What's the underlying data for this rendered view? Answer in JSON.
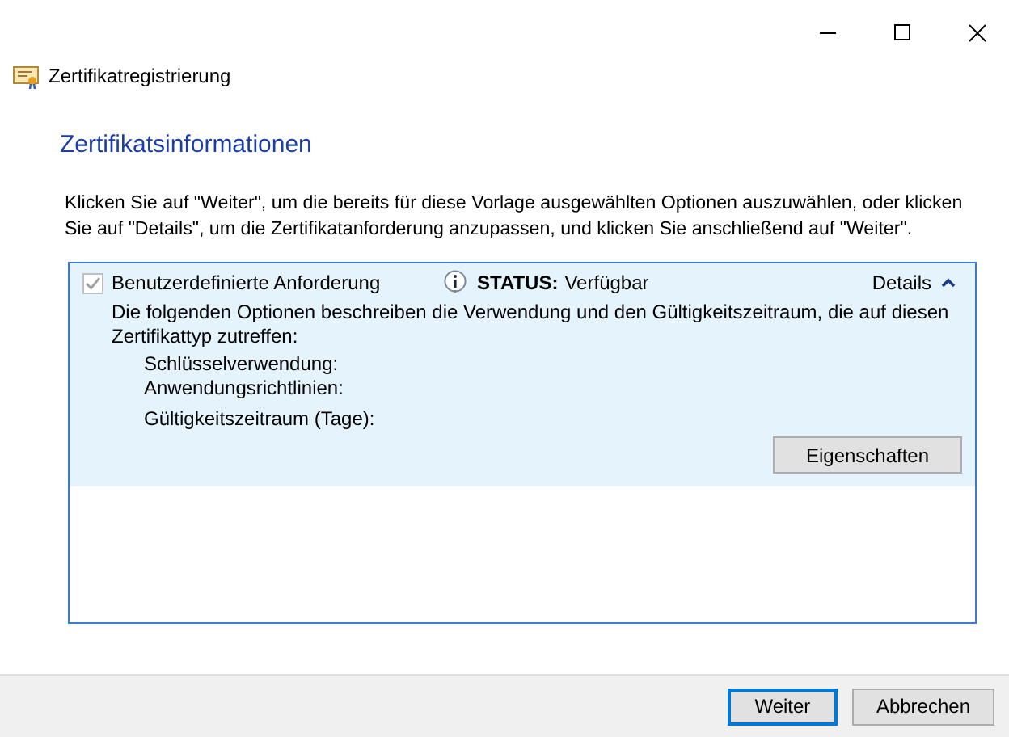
{
  "window": {
    "title": "Zertifikatregistrierung"
  },
  "heading": "Zertifikatsinformationen",
  "instructions": "Klicken Sie auf \"Weiter\", um die bereits für diese Vorlage ausgewählten Optionen auszuwählen, oder klicken Sie auf \"Details\", um die Zertifikatanforderung anzupassen, und klicken Sie anschließend auf \"Weiter\".",
  "request": {
    "label": "Benutzerdefinierte Anforderung",
    "checked": true,
    "disabled": true,
    "selected": true,
    "status_label": "STATUS:",
    "status_value": "Verfügbar",
    "details_label": "Details",
    "expanded": true,
    "description": "Die folgenden Optionen beschreiben die Verwendung und den Gültigkeitszeitraum, die auf diesen Zertifikattyp zutreffen:",
    "fields": [
      "Schlüsselverwendung:",
      "Anwendungsrichtlinien:",
      "Gültigkeitszeitraum (Tage):"
    ],
    "properties_button": "Eigenschaften"
  },
  "buttons": [
    {
      "label": "Weiter",
      "default": true
    },
    {
      "label": "Abbrechen",
      "default": false
    }
  ]
}
